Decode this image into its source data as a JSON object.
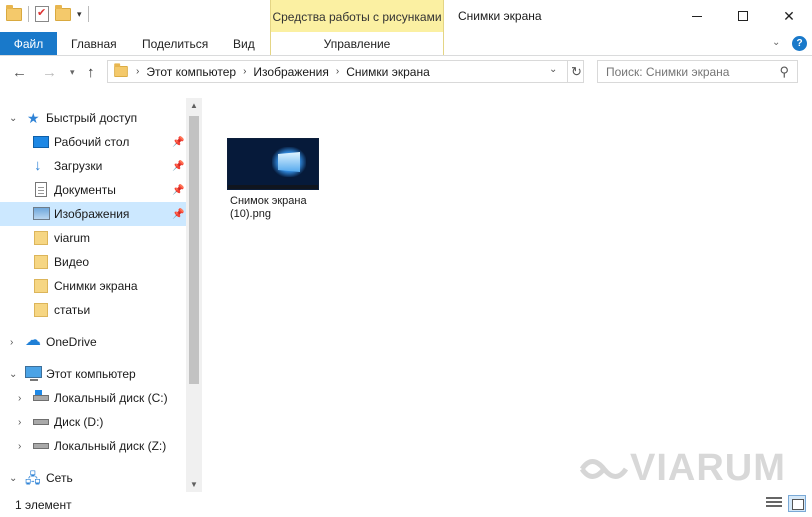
{
  "window": {
    "title": "Снимки экрана",
    "contextual_tab_title": "Средства работы с рисунками"
  },
  "ribbon": {
    "tabs": [
      "Файл",
      "Главная",
      "Поделиться",
      "Вид",
      "Управление"
    ],
    "help": "?"
  },
  "navigation": {
    "breadcrumb": [
      "Этот компьютер",
      "Изображения",
      "Снимки экрана"
    ],
    "search_placeholder": "Поиск: Снимки экрана"
  },
  "sidebar": {
    "quick_access": "Быстрый доступ",
    "items": [
      {
        "label": "Рабочий стол",
        "icon": "desktop-icon",
        "pinned": true
      },
      {
        "label": "Загрузки",
        "icon": "download-icon",
        "pinned": true
      },
      {
        "label": "Документы",
        "icon": "documents-icon",
        "pinned": true
      },
      {
        "label": "Изображения",
        "icon": "pictures-icon",
        "pinned": true,
        "selected": true
      },
      {
        "label": "viarum",
        "icon": "folder-icon"
      },
      {
        "label": "Видео",
        "icon": "folder-icon"
      },
      {
        "label": "Снимки экрана",
        "icon": "folder-icon"
      },
      {
        "label": "статьи",
        "icon": "folder-icon"
      }
    ],
    "onedrive": "OneDrive",
    "this_pc": "Этот компьютер",
    "drives": [
      "Локальный диск (C:)",
      "Диск (D:)",
      "Локальный диск (Z:)"
    ],
    "network": "Сеть"
  },
  "content": {
    "files": [
      {
        "name_line1": "Снимок экрана",
        "name_line2": "(10).png"
      }
    ]
  },
  "status": {
    "count": "1 элемент"
  },
  "watermark": "VIARUM",
  "colors": {
    "file_tab": "#1979ca",
    "contextual": "#fbf0a2",
    "selection": "#cce8ff"
  }
}
